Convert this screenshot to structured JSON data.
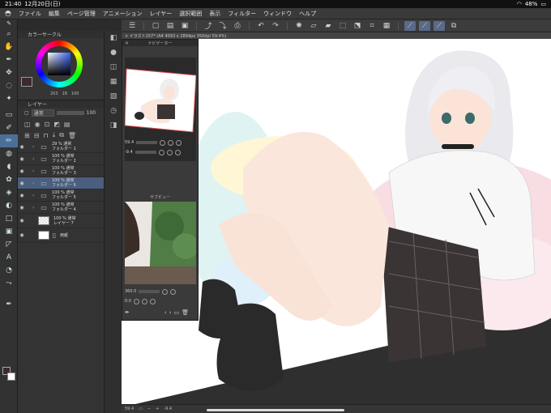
{
  "status": {
    "time": "21:40",
    "date": "12月20日(日)",
    "battery": "48%"
  },
  "menu": {
    "items": [
      "ファイル",
      "編集",
      "ページ管理",
      "アニメーション",
      "レイヤー",
      "選択範囲",
      "表示",
      "フィルター",
      "ウィンドウ",
      "ヘルプ"
    ]
  },
  "color_panel": {
    "title": "カラーサークル",
    "h": "203",
    "s": "18",
    "v": "100",
    "current_color": "#3b2a30"
  },
  "layer_panel": {
    "title": "レイヤー",
    "blend_mode": "通常",
    "opacity": "100",
    "layers": [
      {
        "line1": "29 % 通常",
        "line2": "フォルダー 1",
        "kind": "folder"
      },
      {
        "line1": "100 % 通常",
        "line2": "フォルダー 2",
        "kind": "folder"
      },
      {
        "line1": "100 % 通常",
        "line2": "フォルダー 3",
        "kind": "folder"
      },
      {
        "line1": "100 % 通常",
        "line2": "フォルダー 6",
        "kind": "folder",
        "selected": true
      },
      {
        "line1": "100 % 通常",
        "line2": "フォルダー 5",
        "kind": "folder"
      },
      {
        "line1": "100 % 通常",
        "line2": "フォルダー 4",
        "kind": "folder"
      },
      {
        "line1": "100 % 通常",
        "line2": "レイヤー 7",
        "kind": "raster"
      },
      {
        "line1": "",
        "line2": "用紙",
        "kind": "paper"
      }
    ]
  },
  "canvas": {
    "tab": "× イラスト157* (A4 4093 x 2894px 350dpi 59.4%)"
  },
  "navigator": {
    "title": "ナビゲーター",
    "zoom": "59.4",
    "angle": "-9.4"
  },
  "sub_view": {
    "title": "サブビュー",
    "zoom": "360.0",
    "angle": "0.0"
  },
  "bottom": {
    "zoom": "59.4",
    "angle": "-9.4"
  }
}
